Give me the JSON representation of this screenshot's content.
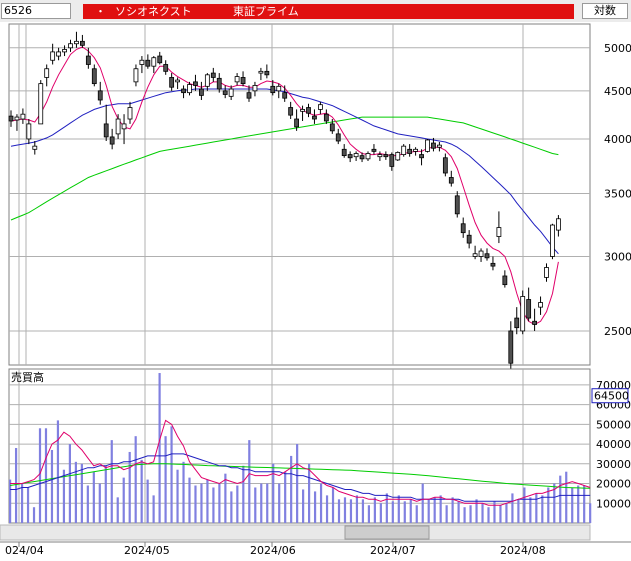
{
  "header": {
    "code": "6526",
    "bullet": "・",
    "name": "ソシオネクスト",
    "market": "東証プライム",
    "scale_mode": "対数"
  },
  "colors": {
    "header_red": "#e01010",
    "candle_up": "#ffffff",
    "candle_down": "#505050",
    "ma_short": "#e0006a",
    "ma_mid": "#2020c0",
    "ma_long": "#00cc00",
    "volume_bar": "#8080e0",
    "grid": "#b0b0b0",
    "badge_border": "#2020c0"
  },
  "chart_data": [
    {
      "type": "candlestick",
      "title": "",
      "yscale": "log",
      "ylim": [
        2300,
        5300
      ],
      "y_ticks": [
        5000,
        4500,
        4000,
        3500,
        3000,
        2500
      ],
      "x_tick_labels": [
        "024/04",
        "2024/05",
        "2024/06",
        "2024/07",
        "2024/08"
      ],
      "ohlc": [
        [
          4230,
          4290,
          4120,
          4180
        ],
        [
          4190,
          4250,
          4080,
          4220
        ],
        [
          4200,
          4310,
          4150,
          4250
        ],
        [
          4000,
          4200,
          3950,
          4150
        ],
        [
          3900,
          3980,
          3850,
          3930
        ],
        [
          4150,
          4620,
          4150,
          4580
        ],
        [
          4650,
          4800,
          4550,
          4750
        ],
        [
          4850,
          5050,
          4800,
          4950
        ],
        [
          4900,
          5000,
          4850,
          4950
        ],
        [
          4950,
          5030,
          4900,
          4980
        ],
        [
          5000,
          5100,
          4950,
          5050
        ],
        [
          5050,
          5200,
          5000,
          5080
        ],
        [
          5080,
          5160,
          5000,
          5030
        ],
        [
          4900,
          5000,
          4750,
          4800
        ],
        [
          4750,
          4800,
          4550,
          4580
        ],
        [
          4500,
          4600,
          4350,
          4400
        ],
        [
          4150,
          4350,
          3980,
          4020
        ],
        [
          4020,
          4100,
          3900,
          3950
        ],
        [
          4050,
          4250,
          4000,
          4200
        ],
        [
          4100,
          4250,
          3950,
          4150
        ],
        [
          4200,
          4380,
          4150,
          4320
        ],
        [
          4600,
          4800,
          4550,
          4750
        ],
        [
          4800,
          4900,
          4700,
          4850
        ],
        [
          4850,
          4920,
          4750,
          4780
        ],
        [
          4780,
          4900,
          4700,
          4880
        ],
        [
          4900,
          4950,
          4800,
          4820
        ],
        [
          4800,
          4850,
          4680,
          4720
        ],
        [
          4650,
          4700,
          4500,
          4540
        ],
        [
          4600,
          4650,
          4520,
          4620
        ],
        [
          4520,
          4560,
          4420,
          4480
        ],
        [
          4480,
          4600,
          4450,
          4570
        ],
        [
          4600,
          4680,
          4500,
          4560
        ],
        [
          4520,
          4600,
          4400,
          4450
        ],
        [
          4550,
          4700,
          4500,
          4680
        ],
        [
          4700,
          4760,
          4600,
          4650
        ],
        [
          4640,
          4700,
          4480,
          4520
        ],
        [
          4500,
          4560,
          4420,
          4460
        ],
        [
          4440,
          4560,
          4400,
          4520
        ],
        [
          4600,
          4700,
          4560,
          4660
        ],
        [
          4650,
          4720,
          4550,
          4580
        ],
        [
          4480,
          4560,
          4380,
          4420
        ],
        [
          4500,
          4600,
          4440,
          4560
        ],
        [
          4700,
          4760,
          4620,
          4720
        ],
        [
          4720,
          4800,
          4640,
          4680
        ],
        [
          4550,
          4620,
          4450,
          4480
        ],
        [
          4500,
          4580,
          4420,
          4550
        ],
        [
          4480,
          4560,
          4380,
          4420
        ],
        [
          4320,
          4380,
          4200,
          4240
        ],
        [
          4200,
          4300,
          4080,
          4120
        ],
        [
          4280,
          4340,
          4180,
          4300
        ],
        [
          4320,
          4360,
          4220,
          4260
        ],
        [
          4230,
          4300,
          4150,
          4200
        ],
        [
          4300,
          4380,
          4250,
          4350
        ],
        [
          4250,
          4300,
          4150,
          4180
        ],
        [
          4150,
          4200,
          4050,
          4080
        ],
        [
          4050,
          4100,
          3950,
          3980
        ],
        [
          3900,
          3950,
          3820,
          3840
        ],
        [
          3850,
          3880,
          3780,
          3820
        ],
        [
          3830,
          3880,
          3790,
          3860
        ],
        [
          3840,
          3870,
          3780,
          3810
        ],
        [
          3810,
          3880,
          3790,
          3860
        ],
        [
          3900,
          3950,
          3850,
          3880
        ],
        [
          3830,
          3880,
          3790,
          3850
        ],
        [
          3850,
          3880,
          3800,
          3830
        ],
        [
          3850,
          3870,
          3700,
          3740
        ],
        [
          3800,
          3880,
          3790,
          3870
        ],
        [
          3850,
          3950,
          3830,
          3930
        ],
        [
          3900,
          3950,
          3830,
          3860
        ],
        [
          3880,
          3920,
          3840,
          3900
        ],
        [
          3850,
          3900,
          3750,
          3820
        ],
        [
          3880,
          4000,
          3870,
          3990
        ],
        [
          3960,
          4010,
          3880,
          3910
        ],
        [
          3920,
          3970,
          3880,
          3940
        ],
        [
          3820,
          3860,
          3650,
          3680
        ],
        [
          3640,
          3700,
          3560,
          3590
        ],
        [
          3480,
          3520,
          3300,
          3330
        ],
        [
          3250,
          3300,
          3140,
          3180
        ],
        [
          3160,
          3200,
          3060,
          3100
        ],
        [
          3000,
          3080,
          2980,
          3020
        ],
        [
          3000,
          3060,
          2960,
          3040
        ],
        [
          3020,
          3060,
          2970,
          2990
        ],
        [
          2950,
          3000,
          2900,
          2930
        ],
        [
          3150,
          3350,
          3100,
          3220
        ],
        [
          2860,
          2900,
          2780,
          2800
        ],
        [
          2500,
          2560,
          2280,
          2310
        ],
        [
          2580,
          2650,
          2480,
          2520
        ],
        [
          2500,
          2760,
          2480,
          2720
        ],
        [
          2700,
          2780,
          2560,
          2580
        ],
        [
          2560,
          2640,
          2500,
          2540
        ],
        [
          2650,
          2720,
          2600,
          2680
        ],
        [
          2850,
          2950,
          2820,
          2920
        ],
        [
          3000,
          3250,
          2980,
          3240
        ],
        [
          3200,
          3320,
          3150,
          3290
        ]
      ],
      "ma_short": [
        4180,
        4190,
        4200,
        4190,
        4170,
        4260,
        4380,
        4540,
        4680,
        4800,
        4920,
        4980,
        5010,
        4960,
        4880,
        4760,
        4560,
        4330,
        4200,
        4120,
        4100,
        4200,
        4380,
        4540,
        4680,
        4780,
        4780,
        4710,
        4660,
        4620,
        4580,
        4560,
        4540,
        4560,
        4600,
        4600,
        4560,
        4540,
        4560,
        4560,
        4540,
        4540,
        4580,
        4610,
        4600,
        4580,
        4530,
        4450,
        4360,
        4290,
        4260,
        4240,
        4250,
        4260,
        4220,
        4140,
        4040,
        3950,
        3900,
        3860,
        3850,
        3850,
        3860,
        3850,
        3840,
        3840,
        3860,
        3870,
        3880,
        3880,
        3910,
        3920,
        3920,
        3890,
        3830,
        3720,
        3560,
        3400,
        3260,
        3160,
        3100,
        3060,
        3040,
        3000,
        2890,
        2740,
        2620,
        2560,
        2540,
        2560,
        2620,
        2740,
        2960
      ],
      "ma_mid": [
        3930,
        3940,
        3950,
        3960,
        3970,
        3990,
        4010,
        4040,
        4080,
        4120,
        4160,
        4200,
        4240,
        4270,
        4300,
        4320,
        4340,
        4350,
        4360,
        4360,
        4360,
        4380,
        4400,
        4420,
        4440,
        4460,
        4480,
        4490,
        4500,
        4510,
        4510,
        4520,
        4520,
        4520,
        4520,
        4520,
        4520,
        4520,
        4520,
        4520,
        4520,
        4520,
        4520,
        4520,
        4510,
        4500,
        4490,
        4470,
        4450,
        4430,
        4420,
        4400,
        4380,
        4360,
        4340,
        4310,
        4280,
        4250,
        4220,
        4190,
        4160,
        4130,
        4110,
        4090,
        4070,
        4050,
        4040,
        4030,
        4020,
        4010,
        4000,
        3990,
        3980,
        3970,
        3950,
        3920,
        3880,
        3840,
        3790,
        3740,
        3690,
        3640,
        3590,
        3540,
        3490,
        3420,
        3360,
        3300,
        3240,
        3190,
        3130,
        3070,
        3020
      ],
      "ma_long": [
        3280,
        3300,
        3320,
        3340,
        3370,
        3400,
        3430,
        3460,
        3490,
        3520,
        3550,
        3580,
        3610,
        3640,
        3660,
        3680,
        3700,
        3720,
        3740,
        3760,
        3780,
        3800,
        3820,
        3840,
        3860,
        3880,
        3890,
        3900,
        3910,
        3920,
        3930,
        3940,
        3950,
        3960,
        3970,
        3980,
        3990,
        4000,
        4010,
        4020,
        4030,
        4040,
        4050,
        4060,
        4070,
        4080,
        4090,
        4100,
        4110,
        4120,
        4130,
        4140,
        4150,
        4160,
        4170,
        4180,
        4190,
        4200,
        4210,
        4220,
        4220,
        4220,
        4220,
        4220,
        4220,
        4220,
        4220,
        4220,
        4220,
        4220,
        4220,
        4210,
        4200,
        4190,
        4180,
        4170,
        4160,
        4140,
        4120,
        4100,
        4080,
        4060,
        4040,
        4020,
        4000,
        3980,
        3960,
        3940,
        3920,
        3900,
        3880,
        3860,
        3850
      ]
    },
    {
      "type": "bar",
      "title": "売買高",
      "ylim": [
        0,
        75000
      ],
      "y_ticks": [
        70000,
        60000,
        50000,
        40000,
        30000,
        20000,
        10000
      ],
      "latest_value_label": "64500",
      "values": [
        22000,
        38000,
        20000,
        18000,
        8000,
        48000,
        48000,
        37000,
        52000,
        27000,
        40000,
        31000,
        30000,
        19000,
        26000,
        20000,
        29000,
        42000,
        13000,
        23000,
        36000,
        44000,
        32000,
        22000,
        14000,
        76000,
        44000,
        49000,
        27000,
        31000,
        23000,
        19000,
        20000,
        22000,
        18000,
        20000,
        25000,
        16000,
        19000,
        29000,
        42000,
        18000,
        20000,
        20000,
        30000,
        20000,
        26000,
        34000,
        40000,
        17000,
        30000,
        16000,
        20000,
        14000,
        18000,
        12000,
        13000,
        12000,
        14000,
        12000,
        9000,
        13000,
        10000,
        15000,
        11000,
        14000,
        11000,
        12000,
        9000,
        20000,
        12000,
        13000,
        14000,
        9000,
        13000,
        11000,
        8000,
        9000,
        12000,
        10000,
        8000,
        11000,
        9000,
        10000,
        15000,
        12000,
        18000,
        13000,
        15000,
        14000,
        18000,
        20000,
        24000,
        26000,
        18000,
        19000,
        19000,
        10000
      ],
      "ma_short": [
        20000,
        20000,
        20000,
        21000,
        22000,
        25000,
        33000,
        40000,
        42000,
        46000,
        44000,
        40000,
        37000,
        33000,
        29000,
        30000,
        28000,
        29000,
        29000,
        27000,
        28000,
        30000,
        31000,
        30000,
        31000,
        42000,
        52000,
        50000,
        44000,
        39000,
        31000,
        27000,
        23000,
        22000,
        21000,
        20000,
        22000,
        21000,
        20000,
        21000,
        25000,
        24000,
        24000,
        24000,
        25000,
        24000,
        26000,
        28000,
        30000,
        28000,
        27000,
        24000,
        21000,
        19000,
        18000,
        16000,
        15000,
        14000,
        13000,
        13000,
        12000,
        12000,
        11000,
        12000,
        12000,
        12000,
        12000,
        12000,
        11000,
        12000,
        12000,
        13000,
        13000,
        12000,
        12000,
        11000,
        10000,
        10000,
        10000,
        10000,
        9000,
        9000,
        9000,
        10000,
        11000,
        12000,
        13000,
        14000,
        15000,
        15000,
        16000,
        17000,
        19000,
        20000,
        21000,
        20000,
        19000,
        18000
      ],
      "ma_mid": [
        17000,
        17000,
        18000,
        18000,
        19000,
        20000,
        21000,
        22000,
        23000,
        24000,
        25000,
        26000,
        27000,
        28000,
        28000,
        29000,
        29000,
        30000,
        30000,
        31000,
        31000,
        32000,
        33000,
        34000,
        34000,
        34000,
        34000,
        35000,
        35000,
        35000,
        34000,
        33000,
        32000,
        31000,
        30000,
        29000,
        29000,
        28000,
        28000,
        27000,
        27000,
        26000,
        26000,
        26000,
        26000,
        26000,
        25000,
        25000,
        24000,
        24000,
        23000,
        22000,
        21000,
        20000,
        19000,
        18000,
        17000,
        17000,
        16000,
        15000,
        15000,
        14000,
        14000,
        14000,
        13000,
        13000,
        13000,
        13000,
        12000,
        12000,
        12000,
        12000,
        12000,
        12000,
        12000,
        12000,
        11000,
        11000,
        11000,
        11000,
        11000,
        11000,
        11000,
        11000,
        11000,
        12000,
        12000,
        12000,
        12000,
        13000,
        13000,
        13000,
        14000,
        14000,
        14000,
        14000,
        14000,
        14000
      ],
      "ma_long": [
        19000,
        19500,
        20000,
        20500,
        21000,
        21500,
        22000,
        22500,
        23000,
        23500,
        24000,
        24500,
        25000,
        25500,
        26000,
        26500,
        27000,
        27500,
        28000,
        28500,
        29000,
        29500,
        29700,
        29900,
        30000,
        30000,
        30000,
        29900,
        29800,
        29700,
        29500,
        29400,
        29300,
        29100,
        29000,
        28900,
        28800,
        28700,
        28600,
        28500,
        28400,
        28300,
        28200,
        28100,
        28000,
        27900,
        27800,
        27700,
        27600,
        27500,
        27400,
        27300,
        27200,
        27100,
        27000,
        26900,
        26800,
        26700,
        26500,
        26300,
        26100,
        25900,
        25700,
        25500,
        25300,
        25100,
        24900,
        24700,
        24500,
        24200,
        23900,
        23600,
        23300,
        23000,
        22700,
        22400,
        22100,
        21800,
        21500,
        21200,
        20900,
        20600,
        20300,
        20000,
        19800,
        19600,
        19400,
        19200,
        19000,
        18800,
        18600,
        18400,
        18200,
        18000,
        17900,
        17800,
        17700,
        17600
      ]
    }
  ]
}
